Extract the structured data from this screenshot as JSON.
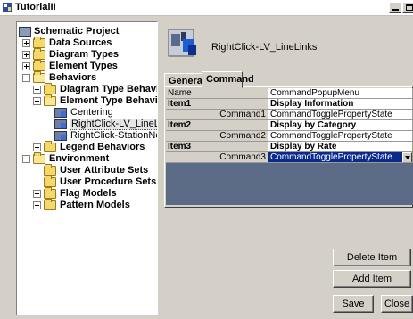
{
  "window": {
    "title": "TutorialII"
  },
  "tree": {
    "nodes": [
      {
        "label": "Schematic Project",
        "bold": true
      },
      {
        "label": "Data Sources",
        "bold": true
      },
      {
        "label": "Diagram Types",
        "bold": true
      },
      {
        "label": "Element Types",
        "bold": true
      },
      {
        "label": "Behaviors",
        "bold": true
      },
      {
        "label": "Diagram Type Behaviors",
        "bold": true
      },
      {
        "label": "Element Type Behaviors",
        "bold": true
      },
      {
        "label": "Centering",
        "bold": false
      },
      {
        "label": "RightClick-LV_LineLinks",
        "bold": false,
        "selected": true
      },
      {
        "label": "RightClick-StationNodes",
        "bold": false
      },
      {
        "label": "Legend Behaviors",
        "bold": true
      },
      {
        "label": "Environment",
        "bold": true
      },
      {
        "label": "User Attribute Sets",
        "bold": true
      },
      {
        "label": "User Procedure Sets",
        "bold": true
      },
      {
        "label": "Flag Models",
        "bold": true
      },
      {
        "label": "Pattern Models",
        "bold": true
      }
    ]
  },
  "detail": {
    "item_name": "RightClick-LV_LineLinks",
    "tabs": [
      {
        "label": "General",
        "active": false
      },
      {
        "label": "Command",
        "active": true
      }
    ]
  },
  "grid": {
    "rows": [
      {
        "key": "Name",
        "value": "CommandPopupMenu",
        "kind": "plain"
      },
      {
        "key": "Item1",
        "value": "Display Information",
        "kind": "group"
      },
      {
        "key": "Command1",
        "value": "CommandTogglePropertyState",
        "kind": "sub"
      },
      {
        "key": "Item2",
        "value": "Display by Category",
        "kind": "group"
      },
      {
        "key": "Command2",
        "value": "CommandTogglePropertyState",
        "kind": "sub"
      },
      {
        "key": "Item3",
        "value": "Display by Rate",
        "kind": "group"
      },
      {
        "key": "Command3",
        "value": "CommandTogglePropertyState",
        "kind": "sub",
        "selected": true
      }
    ]
  },
  "buttons": {
    "delete_item": "Delete Item",
    "add_item": "Add Item",
    "save": "Save",
    "close": "Close"
  },
  "colors": {
    "selection": "#0a2a8c",
    "grid_background": "#5b6b86",
    "dialog": "#d4d0c8"
  }
}
